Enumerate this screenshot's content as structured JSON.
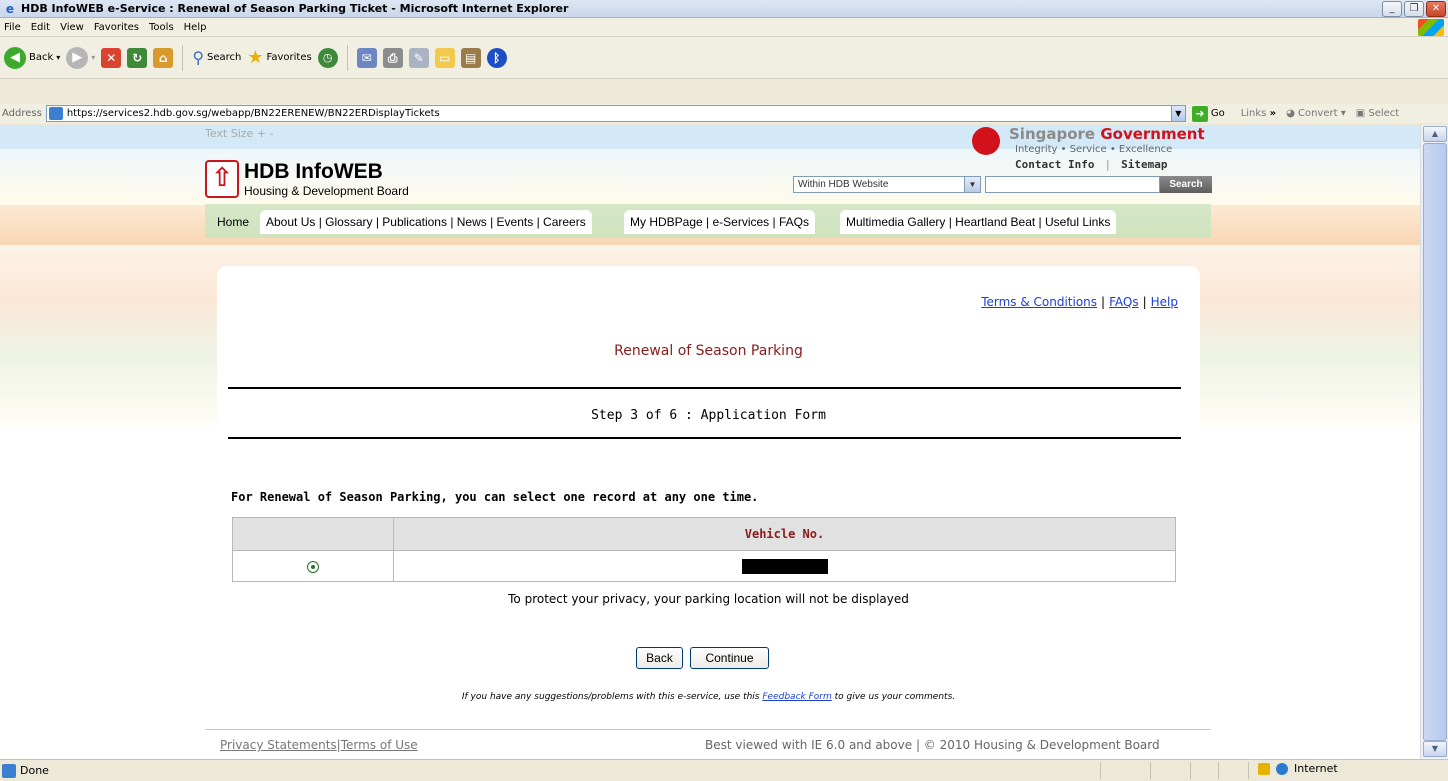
{
  "window": {
    "title": "HDB InfoWEB e-Service : Renewal of Season Parking Ticket - Microsoft Internet Explorer"
  },
  "menu": [
    "File",
    "Edit",
    "View",
    "Favorites",
    "Tools",
    "Help"
  ],
  "toolbar": {
    "back": "Back",
    "search": "Search",
    "favorites": "Favorites"
  },
  "address": {
    "label": "Address",
    "url": "https://services2.hdb.gov.sg/webapp/BN22ERENEW/BN22ERDisplayTickets",
    "go": "Go",
    "links": "Links",
    "convert": "Convert",
    "select": "Select"
  },
  "header": {
    "text_size": "Text Size + -",
    "gov_name_1": "Singapore",
    "gov_name_2": "Government",
    "gov_tagline": "Integrity • Service • Excellence",
    "contact_info": "Contact Info",
    "sitemap": "Sitemap",
    "logo_title": "HDB InfoWEB",
    "logo_sub": "Housing & Development Board",
    "search_scope": "Within HDB Website",
    "search_button": "Search"
  },
  "nav": {
    "home": "Home",
    "tab1": "About Us | Glossary | Publications | News | Events | Careers",
    "tab2": "My HDBPage | e-Services | FAQs",
    "tab3": "Multimedia Gallery | Heartland Beat | Useful Links"
  },
  "content": {
    "terms": "Terms & Conditions",
    "faqs": "FAQs",
    "help": "Help",
    "heading": "Renewal of Season Parking",
    "step": "Step 3 of 6 : Application Form",
    "instruction": "For Renewal of Season Parking, you can select one record at any one time.",
    "column_vehicle": "Vehicle No.",
    "privacy_note": "To protect your privacy, your parking location will not be displayed",
    "back_button": "Back",
    "continue_button": "Continue",
    "feedback_pre": "If you have any suggestions/problems with this e-service, use this",
    "feedback_link": "Feedback Form",
    "feedback_post": "to give us your comments."
  },
  "footer": {
    "privacy": "Privacy Statements",
    "terms": "Terms of Use",
    "right": "Best viewed with IE 6.0 and above | © 2010 Housing & Development Board"
  },
  "status": {
    "done": "Done",
    "zone": "Internet"
  }
}
